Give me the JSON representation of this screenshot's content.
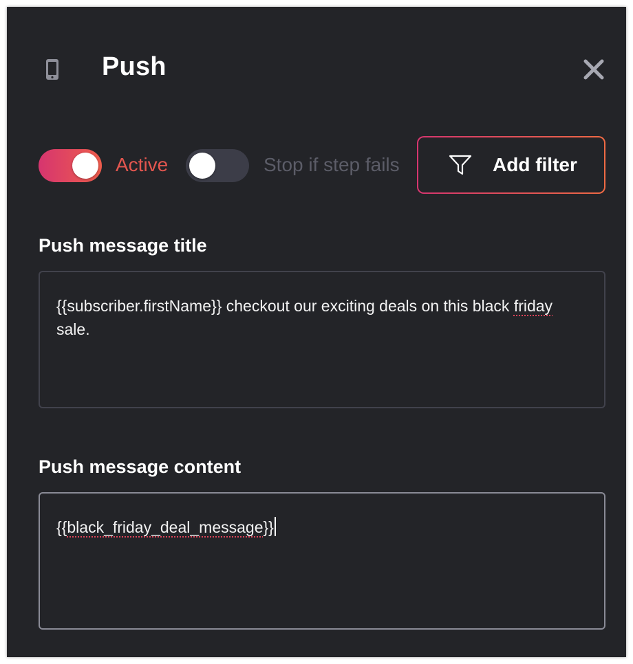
{
  "panel": {
    "title": "Push",
    "icons": {
      "header": "mobile-phone-icon",
      "close": "close-x-icon",
      "filter": "funnel-icon"
    }
  },
  "controls": {
    "active": {
      "label": "Active",
      "on": true
    },
    "stop_if_fails": {
      "label": "Stop if step fails",
      "on": false
    },
    "add_filter_label": "Add filter"
  },
  "fields": {
    "title": {
      "label": "Push message title",
      "value_before": "{{subscriber.firstName}} checkout  our exciting deals on this black ",
      "misspelled": "friday",
      "value_after": " sale."
    },
    "content": {
      "label": "Push message content",
      "value_prefix": "{{",
      "misspelled": "black_friday_deal_message",
      "value_suffix": "}}"
    }
  },
  "colors": {
    "panel_bg": "#232428",
    "accent_gradient_start": "#d6356f",
    "accent_gradient_end": "#ee5d4c",
    "active_label": "#e3564f",
    "muted_label": "#5c5d68"
  }
}
